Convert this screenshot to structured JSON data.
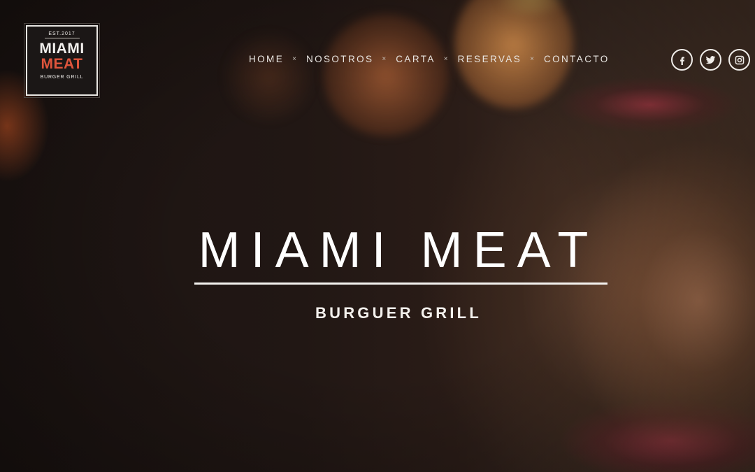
{
  "logo": {
    "est": "EST.2017",
    "line1": "MIAMI",
    "line2": "MEAT",
    "tagline": "BURGER GRILL",
    "accent_color": "#e0553c"
  },
  "nav": {
    "items": [
      {
        "label": "HOME"
      },
      {
        "label": "NOSOTROS"
      },
      {
        "label": "CARTA"
      },
      {
        "label": "RESERVAS"
      },
      {
        "label": "CONTACTO"
      }
    ],
    "separator": "×"
  },
  "social": [
    {
      "icon": "facebook-icon"
    },
    {
      "icon": "twitter-icon"
    },
    {
      "icon": "instagram-icon"
    }
  ],
  "hero": {
    "title": "MIAMI MEAT",
    "subtitle": "BURGUER GRILL"
  }
}
